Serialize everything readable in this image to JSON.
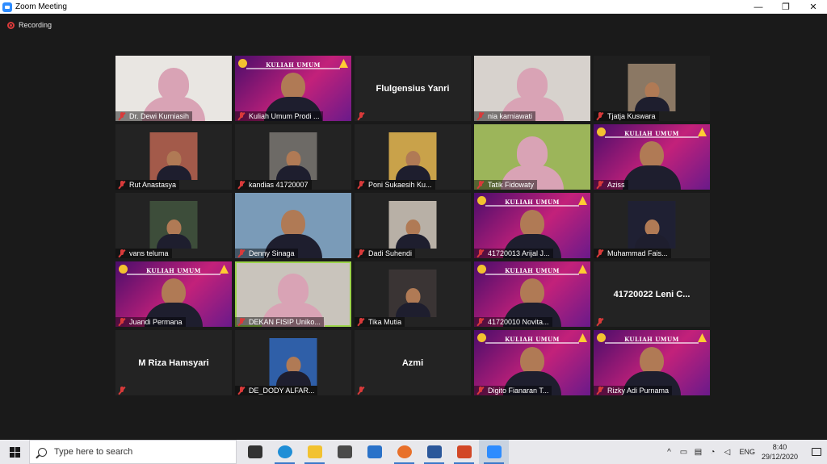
{
  "window": {
    "title": "Zoom Meeting",
    "minimize": "—",
    "restore": "❐",
    "close": "✕"
  },
  "meeting": {
    "recording_label": "Recording",
    "tiles": [
      {
        "name": "Dr. Dewi Kurniasih",
        "kind": "hijab",
        "bg": "#e9e6e2"
      },
      {
        "name": "Kuliah Umum Prodi ...",
        "kind": "kuliah"
      },
      {
        "name": "",
        "kind": "name",
        "display": "Flulgensius Yanri"
      },
      {
        "name": "nia karniawati",
        "kind": "hijab",
        "bg": "#d7d2cd"
      },
      {
        "name": "Tjatja Kuswara",
        "kind": "photo",
        "bg": "#1f1f1f",
        "photo": "#8b7864"
      },
      {
        "name": "Rut Anastasya",
        "kind": "photo",
        "bg": "#232323",
        "photo": "#a35a4a"
      },
      {
        "name": "kandias 41720007",
        "kind": "photo",
        "bg": "#232323",
        "photo": "#6d6a66"
      },
      {
        "name": "Poni Sukaesih Ku...",
        "kind": "photo",
        "bg": "#232323",
        "photo": "#c9a24a"
      },
      {
        "name": "Tatik Fidowaty",
        "kind": "hijab",
        "bg": "#9cb55a"
      },
      {
        "name": "Aziss",
        "kind": "kuliah"
      },
      {
        "name": "vans teluma",
        "kind": "photo",
        "bg": "#232323",
        "photo": "#3d4d3a"
      },
      {
        "name": "Denny Sinaga",
        "kind": "person",
        "bg": "#7a9bb8"
      },
      {
        "name": "Dadi Suhendi",
        "kind": "photo",
        "bg": "#232323",
        "photo": "#b8b0a6"
      },
      {
        "name": "41720013 Arijal J...",
        "kind": "kuliah"
      },
      {
        "name": "Muhammad Fais...",
        "kind": "photo",
        "bg": "#232323",
        "photo": "#1f2033"
      },
      {
        "name": "Juandi Permana",
        "kind": "kuliah"
      },
      {
        "name": "DEKAN FISIP Uniko...",
        "kind": "hijab",
        "bg": "#c9c4bc",
        "active": true
      },
      {
        "name": "Tika Mutia",
        "kind": "photo",
        "bg": "#232323",
        "photo": "#3a3434"
      },
      {
        "name": "41720010 Novita...",
        "kind": "kuliah"
      },
      {
        "name": "",
        "kind": "name",
        "display": "41720022 Leni C..."
      },
      {
        "name": "",
        "kind": "name",
        "display": "M Riza Hamsyari"
      },
      {
        "name": "DE_DODY ALFAR...",
        "kind": "photo",
        "bg": "#232323",
        "photo": "#2f5fa8"
      },
      {
        "name": "",
        "kind": "name",
        "display": "Azmi"
      },
      {
        "name": "Digito Fianaran T...",
        "kind": "kuliah"
      },
      {
        "name": "Rizky Adi Purnama",
        "kind": "kuliah"
      }
    ],
    "kuliah_banner": "KULIAH UMUM"
  },
  "taskbar": {
    "search_placeholder": "Type here to search",
    "apps": [
      {
        "id": "task-view",
        "color": "#333333"
      },
      {
        "id": "edge",
        "color": "#1f8ed6"
      },
      {
        "id": "file-explorer",
        "color": "#f2c230"
      },
      {
        "id": "store",
        "color": "#4a4a4a"
      },
      {
        "id": "mail",
        "color": "#2a72c9"
      },
      {
        "id": "firefox",
        "color": "#e8702a"
      },
      {
        "id": "word",
        "color": "#2b579a"
      },
      {
        "id": "powerpoint",
        "color": "#d24726"
      },
      {
        "id": "zoom",
        "color": "#2d8cff"
      }
    ],
    "tray": {
      "chevron": "^",
      "language": "ENG",
      "time": "8:40",
      "date": "29/12/2020"
    }
  }
}
